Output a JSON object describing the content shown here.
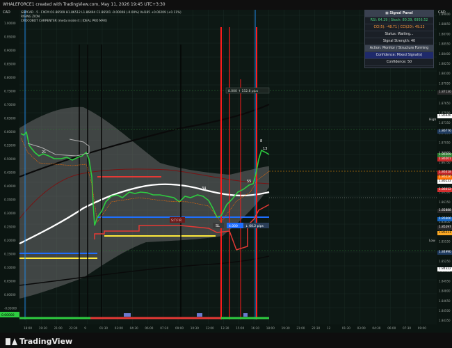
{
  "window": {
    "title": "WHALEFORCE1 created with TradingView.com, May 11, 2026 19:45 UTC+3:30"
  },
  "chart_header": {
    "currency": "CAD",
    "ohlc_line": "GBPCAD · 5 · FXCM  O1.86509  H1.86512  L1.86494  C1.86501  -0.00008 (-0.00%)  Vol185  +0.00209 (+0.11%)",
    "indicator_1": "RISING ZION",
    "indicator_2": "CROCOBOT CARPENTER (meta inside it | IDEAL PRO MAX)"
  },
  "price_axis": {
    "ticks": [
      "1.89000",
      "1.88850",
      "1.88700",
      "1.88550",
      "1.88400",
      "1.88250",
      "1.88100",
      "1.87950",
      "1.87800",
      "1.87650",
      "1.87500",
      "1.87350",
      "1.87200",
      "1.87050",
      "1.86900",
      "1.86750",
      "1.86600",
      "1.86450",
      "1.86300",
      "1.86150",
      "1.86000",
      "1.85850",
      "1.85700",
      "1.85550",
      "1.85400",
      "1.85250",
      "1.85100",
      "1.84950",
      "1.84800",
      "1.84650",
      "1.84500",
      "1.84350"
    ],
    "left_ticks": [
      "1.00000",
      "0.95000",
      "0.90000",
      "0.85000",
      "0.80000",
      "0.75000",
      "0.70000",
      "0.65000",
      "0.60000",
      "0.55000",
      "0.50000",
      "0.45000",
      "0.40000",
      "0.35000",
      "0.30000",
      "0.25000",
      "0.20000",
      "0.15000",
      "0.10000",
      "0.05000",
      "0.00000",
      "-0.05000"
    ],
    "tags": [
      {
        "label": "1.87130",
        "color": "#2a2a2a",
        "text": "#cfcfcf"
      },
      {
        "label": "1.86946",
        "color": "#ffffff",
        "text": "#000000"
      },
      {
        "label": "1.86776",
        "color": "#1e3a5f",
        "text": "#ffffff"
      },
      {
        "label": "1.86509",
        "color": "#2e7d32",
        "text": "#ffffff"
      },
      {
        "label": "1.86501",
        "color": "#c62828",
        "text": "#ffffff"
      },
      {
        "label": "1.86318",
        "color": "#c62828",
        "text": "#ffffff"
      },
      {
        "label": "1.86226",
        "color": "#ff6f00",
        "text": "#ffffff"
      },
      {
        "label": "1.86133",
        "color": "#ffffff",
        "text": "#000000"
      },
      {
        "label": "1.86012",
        "color": "#d32f2f",
        "text": "#ffffff"
      },
      {
        "label": "1.85888",
        "color": "#2a2a2a",
        "text": "#ffffff"
      },
      {
        "label": "1.85606",
        "color": "#1565c0",
        "text": "#ffffff"
      },
      {
        "label": "1.85297",
        "color": "#2a2a2a",
        "text": "#ffffff"
      },
      {
        "label": "1.85211",
        "color": "#f9a825",
        "text": "#000000"
      },
      {
        "label": "1.84990",
        "color": "#1e3a5f",
        "text": "#ffffff"
      },
      {
        "label": "1.84322",
        "color": "#ffffff",
        "text": "#000000"
      }
    ],
    "high_label": "High",
    "low_label": "Low"
  },
  "time_axis": {
    "ticks": [
      "18:00",
      "19:30",
      "21:00",
      "22:30",
      "9",
      "01:30",
      "03:00",
      "04:30",
      "06:00",
      "07:30",
      "09:00",
      "10:30",
      "12:00",
      "13:30",
      "15:00",
      "16:30",
      "18:00",
      "19:30",
      "21:00",
      "22:30",
      "12",
      "01:30",
      "03:00",
      "04:30",
      "06:00",
      "07:30",
      "09:00"
    ]
  },
  "signal_panel": {
    "title": "Signal Panel",
    "rsi_line": "RSI: 64.29 | Stoch: 80.39, 6956.52",
    "cci_line": "CCI(5): -48.71 | CCI(20): 49.23",
    "status_line": "Status: Waiting...",
    "strength_line": "Signal Strength: 40",
    "action_line": "Action: Monitor / Structure Forming",
    "confidence_line": "Confidence: Mixed Signal(s)",
    "confidence_value_line": "Confidence: 50"
  },
  "annotations": {
    "top_box": "8.000  ↑ 152.8 pips",
    "bottom_box_left": "4.000",
    "bottom_box_right": "↓ 60.2 pips",
    "sl_label": "SL",
    "setup_label": "S:T:F:R",
    "wave_label_8": "8",
    "wave_label_13": "13",
    "wave_label_34": "34",
    "wave_label_21": "21",
    "wave_label_55": "55",
    "last_value_label": "0.00000"
  },
  "footer": {
    "brand": "TradingView"
  },
  "colors": {
    "bg": "#0b1511",
    "panel_bg": "#1a1f26",
    "bull": "#2ecc40",
    "bear": "#e53935",
    "accent_blue": "#1e6fff",
    "accent_yellow": "#ffeb3b"
  },
  "icons": [
    "tradingview-logo-icon",
    "signal-panel-icon",
    "chart-settings-icon"
  ]
}
